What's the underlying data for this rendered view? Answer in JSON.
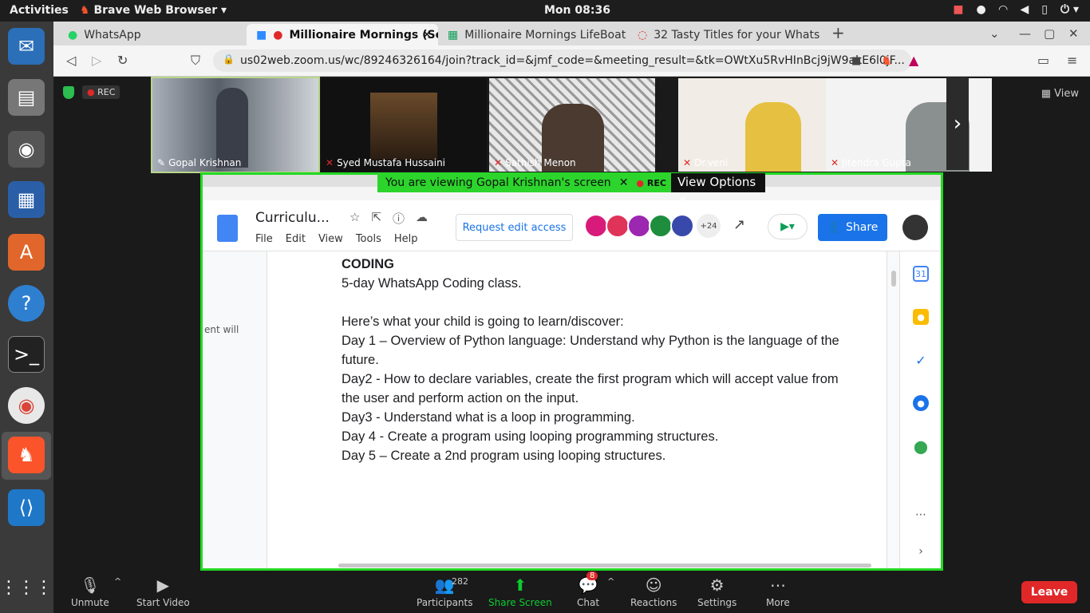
{
  "system": {
    "activities": "Activities",
    "app_name": "Brave Web Browser",
    "clock": "Mon 08:36"
  },
  "browser": {
    "tabs": [
      {
        "label": "WhatsApp"
      },
      {
        "label": "Millionaire Mornings (Se"
      },
      {
        "label": "Millionaire Mornings LifeBoat"
      },
      {
        "label": "32 Tasty Titles for your Whats"
      }
    ],
    "url": "us02web.zoom.us/wc/89246326164/join?track_id=&jmf_code=&meeting_result=&tk=OWtXu5RvHInBcj9jW9akE6l0jF..."
  },
  "zoom": {
    "rec": "REC",
    "view": "View",
    "participants_tiles": [
      {
        "name": "Gopal Krishnan"
      },
      {
        "name": "Syed Mustafa Hussaini"
      },
      {
        "name": "Sathish Menon"
      },
      {
        "name": "Dr.veni"
      },
      {
        "name": "Jitendra Gupta"
      }
    ],
    "banner": {
      "text": "You are viewing Gopal Krishnan's screen",
      "rec": "REC",
      "view_options": "View Options"
    },
    "toolbar": {
      "unmute": "Unmute",
      "start_video": "Start Video",
      "participants": "Participants",
      "participants_count": "282",
      "share_screen": "Share Screen",
      "chat": "Chat",
      "chat_badge": "8",
      "reactions": "Reactions",
      "settings": "Settings",
      "more": "More",
      "leave": "Leave"
    }
  },
  "gdoc": {
    "title": "Curriculu...",
    "menu": [
      "File",
      "Edit",
      "View",
      "Tools",
      "Help"
    ],
    "request_edit": "Request edit access",
    "more_collaborators": "+24",
    "share": "Share",
    "side_note": "ent will",
    "lines": [
      "CODING",
      "5-day WhatsApp Coding class.",
      "",
      "Here’s what your child is going to learn/discover:",
      "Day 1 – Overview of Python language: Understand why Python is the language of the future.",
      "Day2 -   How to declare variables, create the first program which will accept value from the user and perform action on the input.",
      "Day3 -   Understand what is a loop in programming.",
      "Day 4 - Create a program using looping programming structures.",
      "Day 5 – Create a 2nd program using looping structures."
    ]
  }
}
